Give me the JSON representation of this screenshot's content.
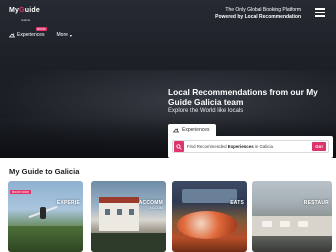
{
  "header": {
    "logo_text_pre": "My",
    "logo_text_hl": "G",
    "logo_text_post": "uide",
    "logo_sub": "Galicia",
    "tagline_line1": "The Only Global Booking Platform",
    "tagline_line2": "Powered by Local Recommendation"
  },
  "nav": {
    "experiences_label": "Experiences",
    "book_badge": "BOOK",
    "more_label": "More"
  },
  "hero": {
    "headline": "Local Recommendations from our My Guide Galicia team",
    "subline": "Explore the World like locals"
  },
  "search": {
    "tab_label": "Experiences",
    "text_pre": "Find Recommended ",
    "text_bold": "Experiences",
    "text_post": " in Galicia",
    "go_label": "Go!"
  },
  "section": {
    "title": "My Guide to Galicia"
  },
  "cards": [
    {
      "label": "EXPERIE",
      "badge": "BOOK NOW"
    },
    {
      "label": "ACCOMM",
      "sub": "ACCOM"
    },
    {
      "label": "EATS"
    },
    {
      "label": "RESTAUR"
    }
  ],
  "colors": {
    "accent": "#e0336b"
  },
  "icons": {
    "experiences": "experiences-icon",
    "search": "search-icon",
    "menu": "hamburger-menu-icon"
  }
}
